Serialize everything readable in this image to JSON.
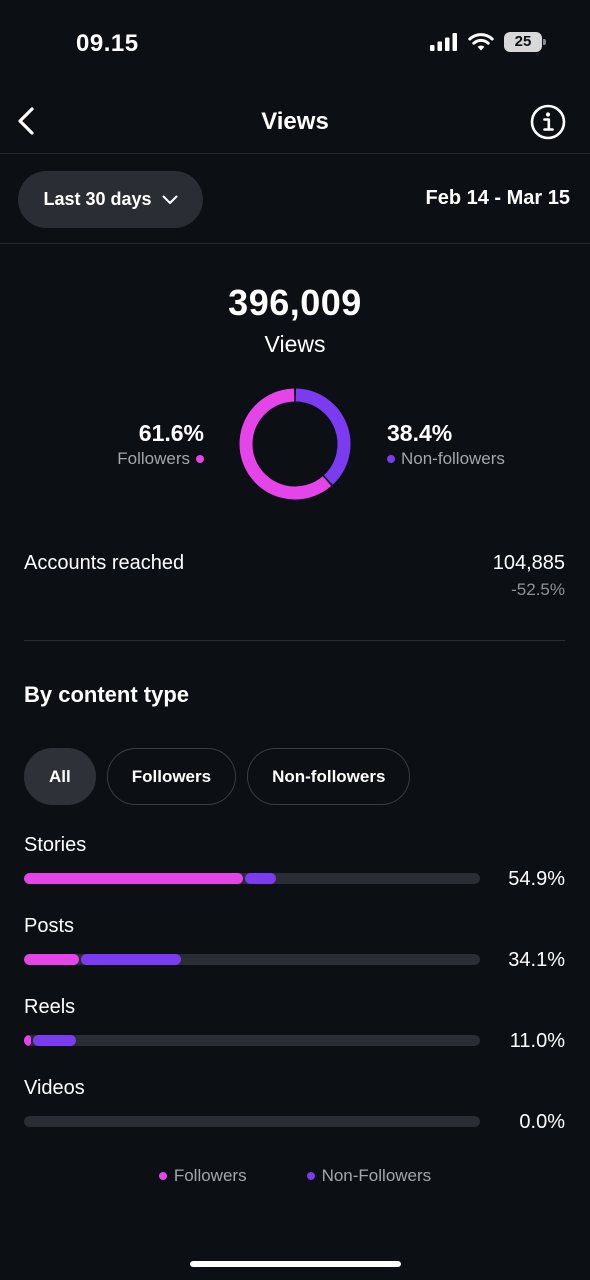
{
  "status_bar": {
    "time": "09.15",
    "battery": "25"
  },
  "nav": {
    "title": "Views",
    "back_icon": "chevron-left-icon",
    "info_icon": "info-circle-icon"
  },
  "filter": {
    "range_label": "Last 30 days",
    "date_range": "Feb 14 - Mar 15"
  },
  "summary": {
    "total_views": "396,009",
    "views_label": "Views",
    "followers_pct": "61.6%",
    "followers_label": "Followers",
    "nonfollowers_pct": "38.4%",
    "nonfollowers_label": "Non-followers",
    "followers_share": 61.6,
    "nonfollowers_share": 38.4
  },
  "reach": {
    "label": "Accounts reached",
    "value": "104,885",
    "change": "-52.5%"
  },
  "content_type": {
    "title": "By content type",
    "tabs": [
      {
        "label": "All",
        "active": true
      },
      {
        "label": "Followers",
        "active": false
      },
      {
        "label": "Non-followers",
        "active": false
      }
    ],
    "rows": [
      {
        "label": "Stories",
        "pct": "54.9%",
        "followers": 48.0,
        "nonfollowers": 6.9
      },
      {
        "label": "Posts",
        "pct": "34.1%",
        "followers": 12.0,
        "nonfollowers": 22.1
      },
      {
        "label": "Reels",
        "pct": "11.0%",
        "followers": 1.5,
        "nonfollowers": 9.5
      },
      {
        "label": "Videos",
        "pct": "0.0%",
        "followers": 0,
        "nonfollowers": 0
      }
    ],
    "legend": [
      {
        "label": "Followers",
        "color": "#e545e8"
      },
      {
        "label": "Non-Followers",
        "color": "#7b3bf0"
      }
    ]
  },
  "colors": {
    "followers": "#e545e8",
    "nonfollowers": "#7b3bf0",
    "background": "#0c0f14",
    "track": "#2a2d33"
  }
}
